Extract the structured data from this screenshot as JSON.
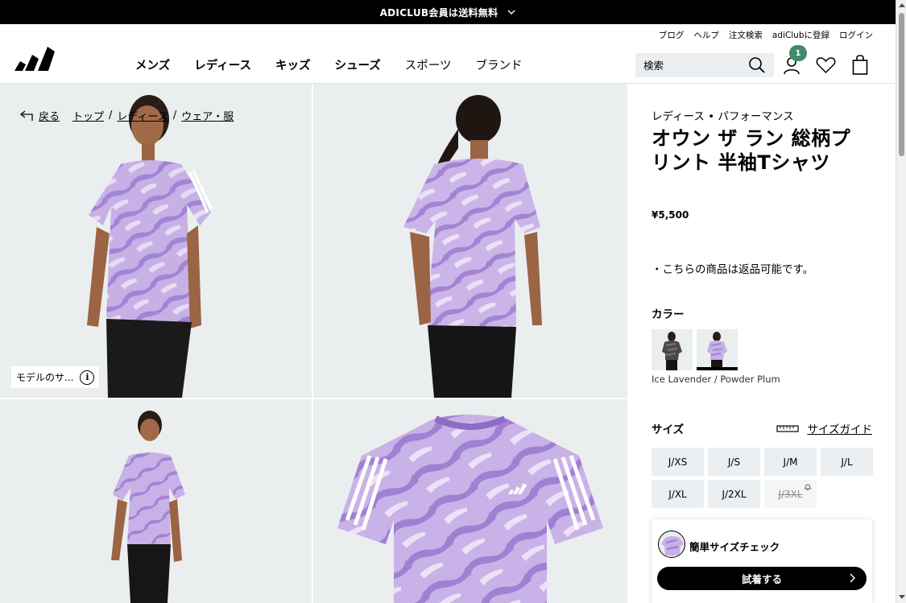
{
  "promo": {
    "text": "ADICLUB会員は送料無料"
  },
  "header": {
    "util_links": [
      "ブログ",
      "ヘルプ",
      "注文検索",
      "adiClubに登録",
      "ログイン"
    ],
    "nav": [
      {
        "label": "メンズ",
        "bold": true
      },
      {
        "label": "レディース",
        "bold": true
      },
      {
        "label": "キッズ",
        "bold": true
      },
      {
        "label": "シューズ",
        "bold": true
      },
      {
        "label": "スポーツ",
        "bold": false
      },
      {
        "label": "ブランド",
        "bold": false
      }
    ],
    "search_placeholder": "検索",
    "account_badge": "1"
  },
  "breadcrumb": {
    "back": "戻る",
    "items": [
      "トップ",
      "レディース",
      "ウェア・服"
    ],
    "separator": "/"
  },
  "gallery": {
    "model_chip": "モデルのサ...",
    "info_glyph": "i"
  },
  "product": {
    "category": "レディース • パフォーマンス",
    "title": "オウン ザ ラン 総柄プリント 半袖Tシャツ",
    "price": "¥5,500",
    "returns": "・こちらの商品は返品可能です。",
    "color_label": "カラー",
    "color_name": "Ice Lavender / Powder Plum",
    "size_label": "サイズ",
    "size_guide": "サイズガイド",
    "sizes": [
      {
        "label": "J/XS",
        "available": true
      },
      {
        "label": "J/S",
        "available": true
      },
      {
        "label": "J/M",
        "available": true
      },
      {
        "label": "J/L",
        "available": true
      },
      {
        "label": "J/XL",
        "available": true
      },
      {
        "label": "J/2XL",
        "available": true
      },
      {
        "label": "J/3XL",
        "available": false
      }
    ],
    "fit_check": {
      "title": "簡単サイズチェック",
      "button": "試着する"
    }
  },
  "colors": {
    "shirt_light": "#c9b3e6",
    "shirt_mid": "#a98ad6",
    "shirt_dark": "#8c6cc6",
    "tile_bg": "#eaeeef",
    "badge": "#3f8a6a"
  }
}
